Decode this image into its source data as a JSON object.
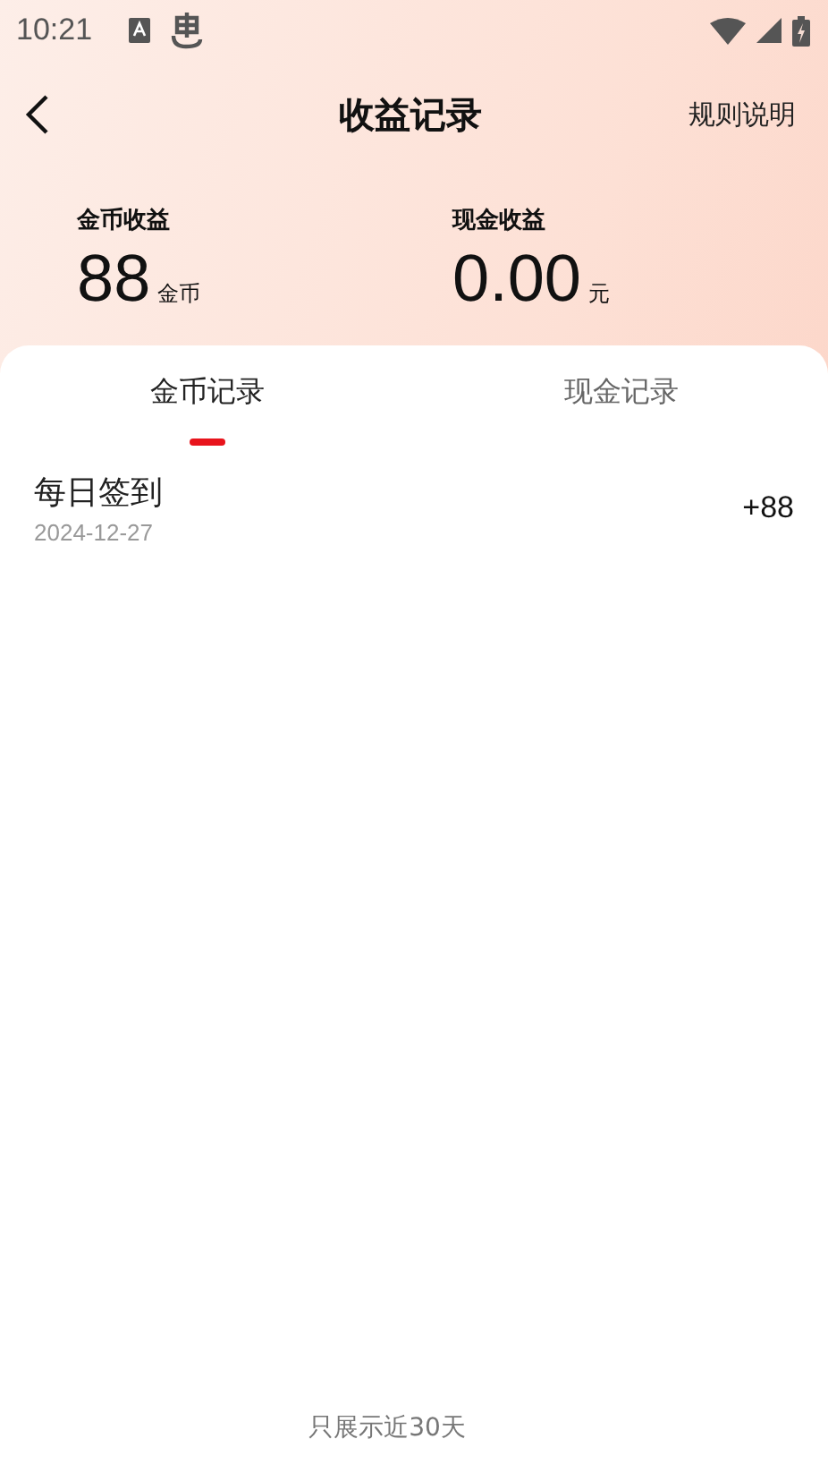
{
  "status_bar": {
    "time": "10:21"
  },
  "header": {
    "title": "收益记录",
    "action": "规则说明"
  },
  "stats": [
    {
      "label": "金币收益",
      "value": "88",
      "unit": "金币"
    },
    {
      "label": "现金收益",
      "value": "0.00",
      "unit": "元"
    }
  ],
  "tabs": [
    {
      "label": "金币记录",
      "selected": true
    },
    {
      "label": "现金记录",
      "selected": false
    }
  ],
  "records": [
    {
      "title": "每日签到",
      "date": "2024-12-27",
      "amount": "+88"
    }
  ],
  "footer": "只展示近30天"
}
